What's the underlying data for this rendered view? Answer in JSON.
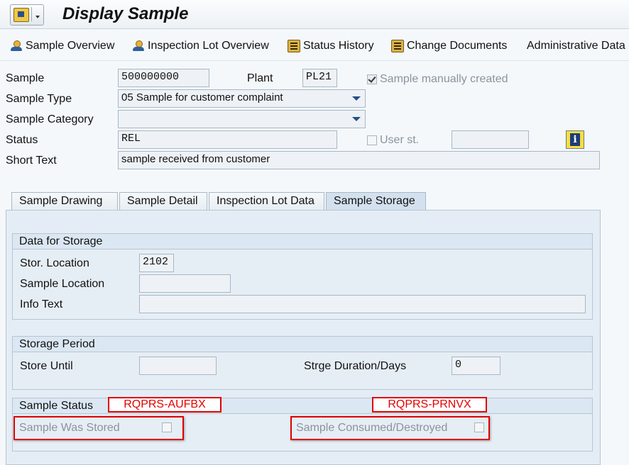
{
  "header": {
    "title": "Display Sample"
  },
  "toolbar": {
    "items": [
      {
        "label": "Sample Overview",
        "icon": "person-icon"
      },
      {
        "label": "Inspection Lot Overview",
        "icon": "person-icon"
      },
      {
        "label": "Status History",
        "icon": "history-icon"
      },
      {
        "label": "Change Documents",
        "icon": "history-icon"
      },
      {
        "label": "Administrative Data",
        "icon": ""
      }
    ]
  },
  "form": {
    "sample_label": "Sample",
    "sample_value": "500000000",
    "plant_label": "Plant",
    "plant_value": "PL21",
    "manual_label": "Sample manually created",
    "type_label": "Sample Type",
    "type_value": "05 Sample for customer complaint",
    "category_label": "Sample Category",
    "category_value": "",
    "status_label": "Status",
    "status_value": "REL",
    "userst_label": "User st.",
    "userst_value": "",
    "shorttext_label": "Short Text",
    "shorttext_value": "sample received from customer"
  },
  "tabs": [
    "Sample Drawing",
    "Sample Detail",
    "Inspection Lot Data",
    "Sample Storage"
  ],
  "storage": {
    "title": "Data for Storage",
    "storloc_label": "Stor. Location",
    "storloc_value": "2102",
    "samploc_label": "Sample Location",
    "samploc_value": "",
    "info_label": "Info Text",
    "info_value": ""
  },
  "period": {
    "title": "Storage Period",
    "until_label": "Store Until",
    "until_value": "",
    "duration_label": "Strge Duration/Days",
    "duration_value": "0"
  },
  "sstatus": {
    "title": "Sample Status",
    "tag1": "RQPRS-AUFBX",
    "tag2": "RQPRS-PRNVX",
    "stored_label": "Sample Was Stored",
    "consumed_label": "Sample Consumed/Destroyed"
  },
  "colors": {
    "annotation": "#e10000",
    "tab_active": "#d3e1ef",
    "background": "#f4f8fb"
  }
}
